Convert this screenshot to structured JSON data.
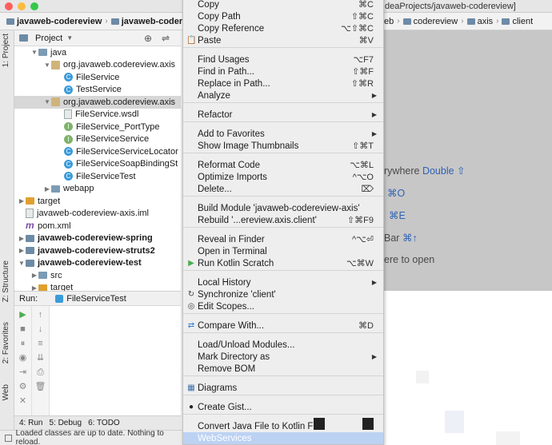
{
  "window": {
    "title_fragment": "deaProjects/javaweb-codereview]"
  },
  "breadcrumb_left": [
    "javaweb-codereview",
    "javaweb-codereview"
  ],
  "breadcrumb_right": [
    "eb",
    "codereview",
    "axis",
    "client"
  ],
  "sidebar_strip": {
    "project": "1: Project",
    "structure": "Z: Structure",
    "favorites": "2: Favorites",
    "web": "Web"
  },
  "project_panel": {
    "title": "Project"
  },
  "tree": [
    {
      "label": "java",
      "indent": 1,
      "icon": "folder",
      "arrow": "down"
    },
    {
      "label": "org.javaweb.codereview.axis",
      "indent": 2,
      "icon": "package",
      "arrow": "down"
    },
    {
      "label": "FileService",
      "indent": 3,
      "icon": "class",
      "arrow": ""
    },
    {
      "label": "TestService",
      "indent": 3,
      "icon": "class",
      "arrow": ""
    },
    {
      "label": "org.javaweb.codereview.axis",
      "indent": 2,
      "icon": "package",
      "arrow": "down",
      "selected": true
    },
    {
      "label": "FileService.wsdl",
      "indent": 3,
      "icon": "file",
      "arrow": ""
    },
    {
      "label": "FileService_PortType",
      "indent": 3,
      "icon": "interface",
      "arrow": ""
    },
    {
      "label": "FileServiceService",
      "indent": 3,
      "icon": "interface",
      "arrow": ""
    },
    {
      "label": "FileServiceServiceLocator",
      "indent": 3,
      "icon": "class",
      "arrow": ""
    },
    {
      "label": "FileServiceSoapBindingSt",
      "indent": 3,
      "icon": "class",
      "arrow": ""
    },
    {
      "label": "FileServiceTest",
      "indent": 3,
      "icon": "class",
      "arrow": ""
    },
    {
      "label": "webapp",
      "indent": 2,
      "icon": "folder",
      "arrow": "right"
    },
    {
      "label": "target",
      "indent": 0,
      "icon": "orange-folder",
      "arrow": "right"
    },
    {
      "label": "javaweb-codereview-axis.iml",
      "indent": 0,
      "icon": "file",
      "arrow": ""
    },
    {
      "label": "pom.xml",
      "indent": 0,
      "icon": "maven",
      "arrow": ""
    },
    {
      "label": "javaweb-codereview-spring",
      "indent": 0,
      "icon": "module",
      "arrow": "right",
      "bold": true
    },
    {
      "label": "javaweb-codereview-struts2",
      "indent": 0,
      "icon": "module",
      "arrow": "right",
      "bold": true
    },
    {
      "label": "javaweb-codereview-test",
      "indent": 0,
      "icon": "module",
      "arrow": "down",
      "bold": true
    },
    {
      "label": "src",
      "indent": 1,
      "icon": "folder",
      "arrow": "right"
    },
    {
      "label": "target",
      "indent": 1,
      "icon": "orange-folder",
      "arrow": "right"
    }
  ],
  "run_panel": {
    "label": "Run:",
    "config": "FileServiceTest"
  },
  "bottom_tabs": [
    "4: Run",
    "5: Debug",
    "6: TODO"
  ],
  "status": "Loaded classes are up to date. Nothing to reload.",
  "welcome": {
    "search_prefix": "rywhere ",
    "search_key": "Double ⇧",
    "k1": "⌘O",
    "k2": "⌘E",
    "nav_prefix": "Bar ",
    "nav_key": "⌘↑",
    "open_text": "ere to open"
  },
  "menu": {
    "items": [
      {
        "label": "Copy",
        "shortcut": "⌘C"
      },
      {
        "label": "Copy Path",
        "shortcut": "⇧⌘C"
      },
      {
        "label": "Copy Reference",
        "shortcut": "⌥⇧⌘C"
      },
      {
        "label": "Paste",
        "shortcut": "⌘V",
        "icon": "paste"
      },
      {
        "label": "Find Usages",
        "shortcut": "⌥F7"
      },
      {
        "label": "Find in Path...",
        "shortcut": "⇧⌘F"
      },
      {
        "label": "Replace in Path...",
        "shortcut": "⇧⌘R"
      },
      {
        "label": "Analyze",
        "submenu": true
      },
      {
        "label": "Refactor",
        "submenu": true
      },
      {
        "label": "Add to Favorites",
        "submenu": true
      },
      {
        "label": "Show Image Thumbnails",
        "shortcut": "⇧⌘T"
      },
      {
        "label": "Reformat Code",
        "shortcut": "⌥⌘L"
      },
      {
        "label": "Optimize Imports",
        "shortcut": "^⌥O"
      },
      {
        "label": "Delete...",
        "shortcut": "⌦"
      },
      {
        "label": "Build Module 'javaweb-codereview-axis'"
      },
      {
        "label": "Rebuild '...ereview.axis.client'",
        "shortcut": "⇧⌘F9"
      },
      {
        "label": "Reveal in Finder",
        "shortcut": "^⌥⏎"
      },
      {
        "label": "Open in Terminal"
      },
      {
        "label": "Run Kotlin Scratch",
        "shortcut": "⌥⌘W",
        "icon": "run"
      },
      {
        "label": "Local History",
        "submenu": true
      },
      {
        "label": "Synchronize 'client'",
        "icon": "sync"
      },
      {
        "label": "Edit Scopes...",
        "icon": "scope"
      },
      {
        "label": "Compare With...",
        "shortcut": "⌘D",
        "icon": "compare"
      },
      {
        "label": "Load/Unload Modules..."
      },
      {
        "label": "Mark Directory as",
        "submenu": true
      },
      {
        "label": "Remove BOM"
      },
      {
        "label": "Diagrams",
        "icon": "diagram"
      },
      {
        "label": "Create Gist...",
        "icon": "github"
      },
      {
        "label": "Convert Java File to Kotlin F"
      },
      {
        "label": "WebServices",
        "highlighted": true
      }
    ]
  },
  "colors": {
    "menu_bg": "#eeeeee",
    "highlight": "#bcd2f3",
    "welcome_bg": "#c7c7c7",
    "key_blue": "#2f62b5",
    "run_green": "#4caf50"
  }
}
